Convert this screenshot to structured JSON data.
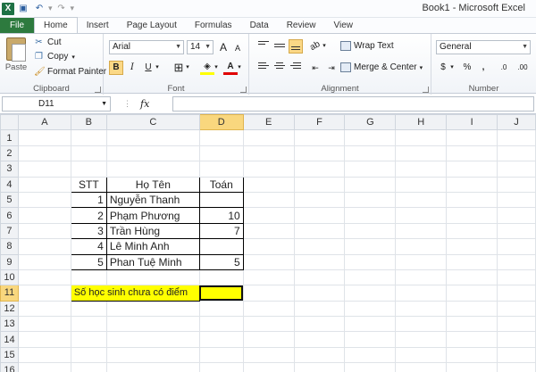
{
  "window": {
    "title": "Book1 - Microsoft Excel"
  },
  "tabs": [
    {
      "label": "File"
    },
    {
      "label": "Home"
    },
    {
      "label": "Insert"
    },
    {
      "label": "Page Layout"
    },
    {
      "label": "Formulas"
    },
    {
      "label": "Data"
    },
    {
      "label": "Review"
    },
    {
      "label": "View"
    }
  ],
  "ribbon": {
    "clipboard": {
      "paste": "Paste",
      "cut": "Cut",
      "copy": "Copy",
      "format_painter": "Format Painter",
      "label": "Clipboard"
    },
    "font": {
      "name": "Arial",
      "size": "14",
      "bold": "B",
      "italic": "I",
      "underline": "U",
      "grow": "A",
      "shrink": "A",
      "label": "Font"
    },
    "alignment": {
      "wrap": "Wrap Text",
      "merge": "Merge & Center",
      "label": "Alignment"
    },
    "number": {
      "format": "General",
      "currency": "$",
      "percent": "%",
      "comma": ",",
      "inc_dec": ".0",
      "dec_dec": ".00",
      "label": "Number"
    }
  },
  "formula_bar": {
    "name_box": "D11",
    "fx": "fx",
    "formula": ""
  },
  "columns": [
    "A",
    "B",
    "C",
    "D",
    "E",
    "F",
    "G",
    "H",
    "I",
    "J"
  ],
  "rows": [
    "1",
    "2",
    "3",
    "4",
    "5",
    "6",
    "7",
    "8",
    "9",
    "10",
    "11",
    "12",
    "13",
    "14",
    "15",
    "16"
  ],
  "table": {
    "headers": {
      "stt": "STT",
      "name": "Họ Tên",
      "math": "Toán"
    },
    "rows": [
      {
        "stt": "1",
        "name": "Nguyễn Thanh",
        "math": ""
      },
      {
        "stt": "2",
        "name": "Phạm Phương",
        "math": "10"
      },
      {
        "stt": "3",
        "name": "Trần Hùng",
        "math": "7"
      },
      {
        "stt": "4",
        "name": "Lê Minh Anh",
        "math": ""
      },
      {
        "stt": "5",
        "name": "Phan Tuệ Minh",
        "math": "5"
      }
    ],
    "summary_label": "Số học sinh chưa có điểm",
    "summary_value": ""
  },
  "colors": {
    "selection": "#ffff00",
    "file_tab": "#2d7a3e",
    "active_header": "#f9d77e"
  }
}
